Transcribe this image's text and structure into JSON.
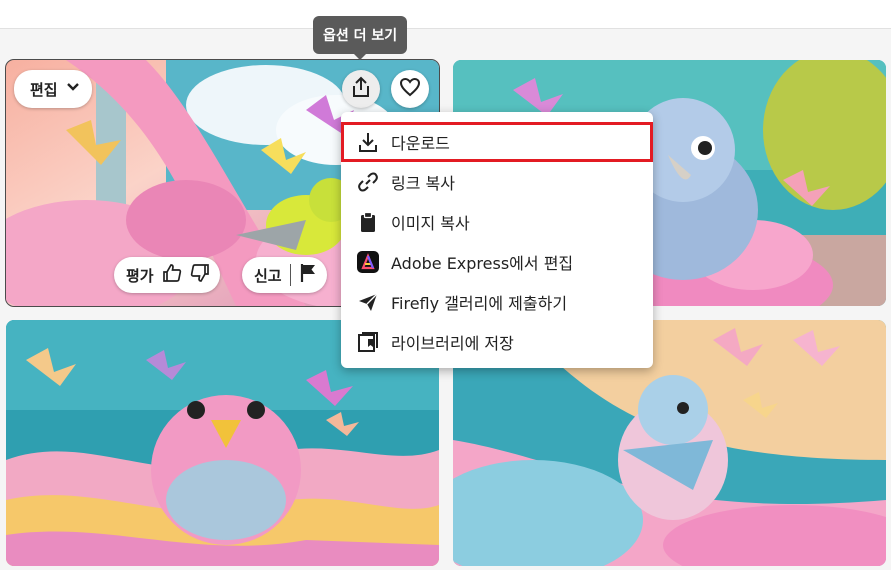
{
  "tooltip": {
    "more_options": "옵션 더 보기"
  },
  "card_controls": {
    "edit_label": "편집",
    "rate_label": "평가",
    "report_label": "신고"
  },
  "menu": {
    "items": [
      {
        "label": "다운로드",
        "icon": "download-icon"
      },
      {
        "label": "링크 복사",
        "icon": "link-icon"
      },
      {
        "label": "이미지 복사",
        "icon": "clipboard-icon"
      },
      {
        "label": "Adobe Express에서 편집",
        "icon": "adobe-express-icon"
      },
      {
        "label": "Firefly 갤러리에 제출하기",
        "icon": "send-icon"
      },
      {
        "label": "라이브러리에 저장",
        "icon": "library-icon"
      }
    ],
    "highlight_color": "#e31b23"
  },
  "gallery": {
    "images": [
      {
        "subject": "yellow-green parrot with butterflies"
      },
      {
        "subject": "blue parrot on pink paper"
      },
      {
        "subject": "pink parrot with butterflies"
      },
      {
        "subject": "blue-pink parrot on paper waves"
      }
    ]
  }
}
